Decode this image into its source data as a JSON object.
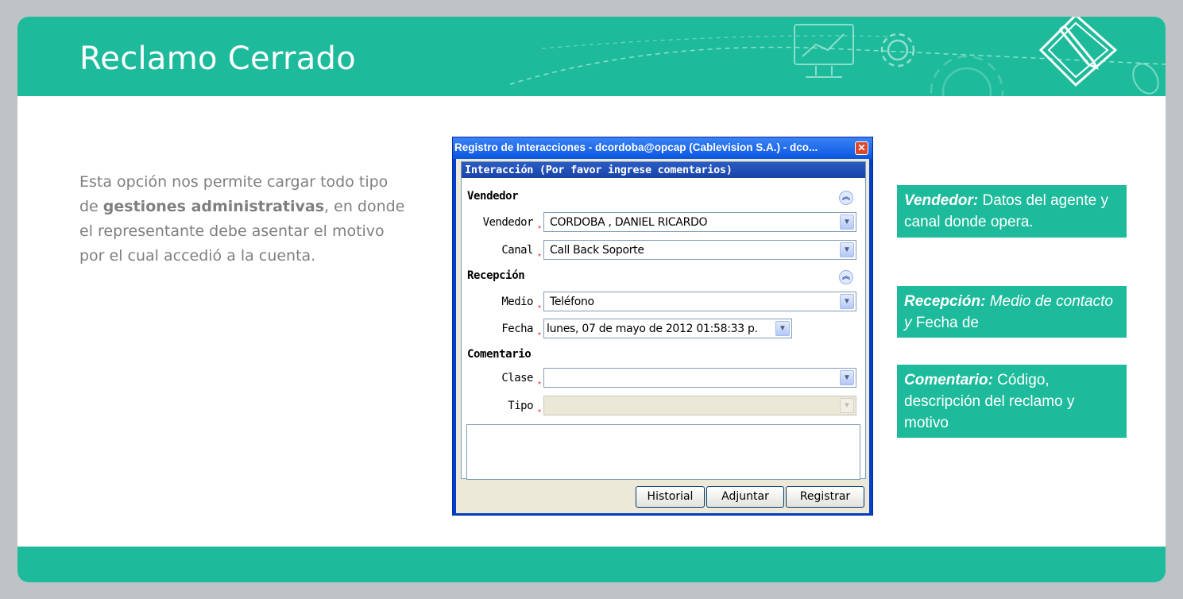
{
  "slide": {
    "title": "Reclamo Cerrado",
    "description": {
      "part1": "Esta opción nos permite cargar todo tipo de ",
      "bold": "gestiones administrativas",
      "part2": ", en donde el representante debe asentar el motivo por el cual accedió a la cuenta."
    }
  },
  "dialog": {
    "title": "Registro de Interacciones - dcordoba@opcap (Cablevision S.A.) - dco...",
    "close_glyph": "✕",
    "panel_header": "Interacción (Por favor ingrese comentarios)",
    "sections": {
      "vendedor": "Vendedor",
      "recepcion": "Recepción",
      "comentario": "Comentario"
    },
    "collapse_glyph": "︽",
    "fields": {
      "vendedor": {
        "label": "Vendedor",
        "value": "CORDOBA , DANIEL RICARDO"
      },
      "canal": {
        "label": "Canal",
        "value": "Call Back Soporte"
      },
      "medio": {
        "label": "Medio",
        "value": "Teléfono"
      },
      "fecha": {
        "label": "Fecha",
        "value": "lunes, 07 de mayo de 2012 01:58:33 p."
      },
      "clase": {
        "label": "Clase",
        "value": ""
      },
      "tipo": {
        "label": "Tipo",
        "value": ""
      }
    },
    "required_mark": "*",
    "dropdown_glyph": "▼",
    "buttons": {
      "historial": "Historial",
      "adjuntar": "Adjuntar",
      "registrar": "Registrar"
    }
  },
  "callouts": {
    "vendedor": {
      "heading": "Vendedor:",
      "text": " Datos del agente y canal donde opera."
    },
    "recepcion": {
      "heading": "Recepción:",
      "italic_text": " Medio de contacto y",
      "text": " Fecha de"
    },
    "comentario": {
      "heading": "Comentario:",
      "text": " Código, descripción del reclamo y motivo"
    }
  },
  "colors": {
    "accent": "#1dbb9b",
    "background": "#bfc3c6",
    "dialog_blue": "#0a55e0"
  }
}
